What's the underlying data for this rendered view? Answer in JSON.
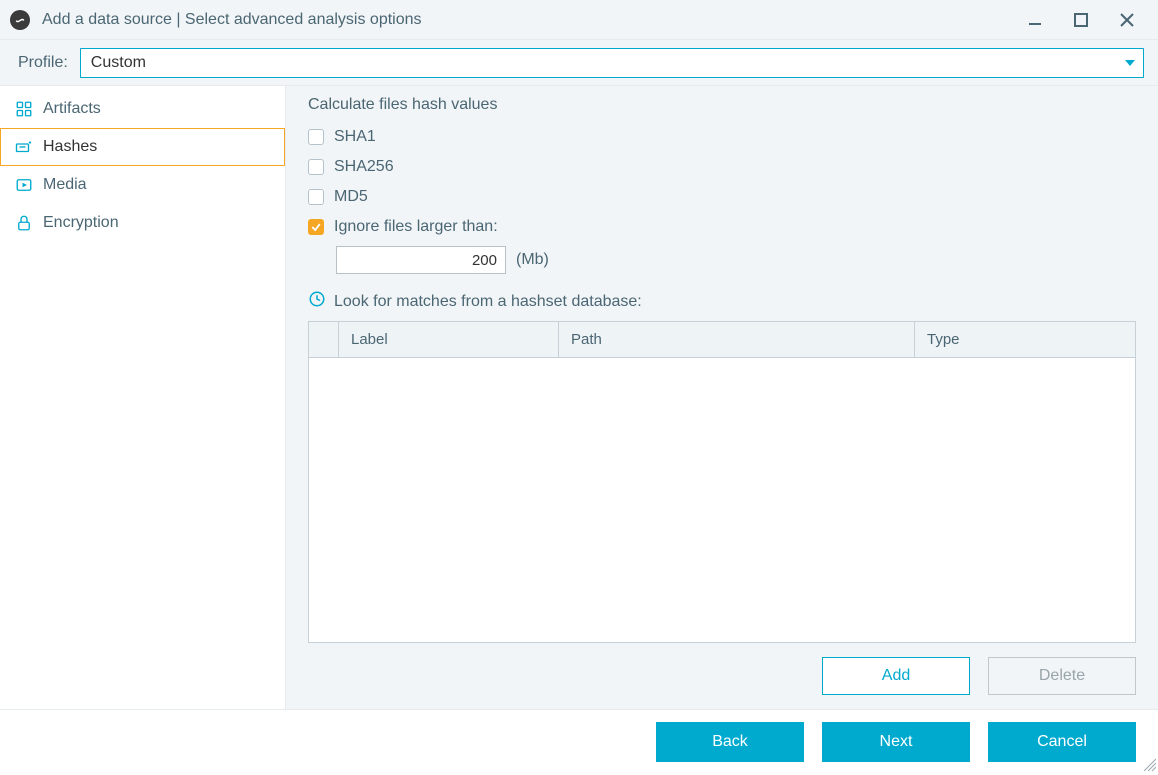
{
  "window": {
    "title": "Add a data source | Select advanced analysis options"
  },
  "profile": {
    "label": "Profile:",
    "value": "Custom"
  },
  "sidebar": {
    "items": [
      {
        "label": "Artifacts",
        "icon": "grid-icon"
      },
      {
        "label": "Hashes",
        "icon": "hash-icon"
      },
      {
        "label": "Media",
        "icon": "play-icon"
      },
      {
        "label": "Encryption",
        "icon": "lock-icon"
      }
    ],
    "selected_index": 1
  },
  "main": {
    "section_title": "Calculate files hash values",
    "hash_options": [
      {
        "label": "SHA1",
        "checked": false
      },
      {
        "label": "SHA256",
        "checked": false
      },
      {
        "label": "MD5",
        "checked": false
      }
    ],
    "ignore": {
      "label": "Ignore files larger than:",
      "checked": true,
      "value": "200",
      "unit": "(Mb)"
    },
    "hashset_label": "Look for matches from a hashset database:",
    "table": {
      "headers": {
        "label": "Label",
        "path": "Path",
        "type": "Type"
      }
    },
    "buttons": {
      "add": "Add",
      "delete": "Delete"
    }
  },
  "footer": {
    "back": "Back",
    "next": "Next",
    "cancel": "Cancel"
  }
}
